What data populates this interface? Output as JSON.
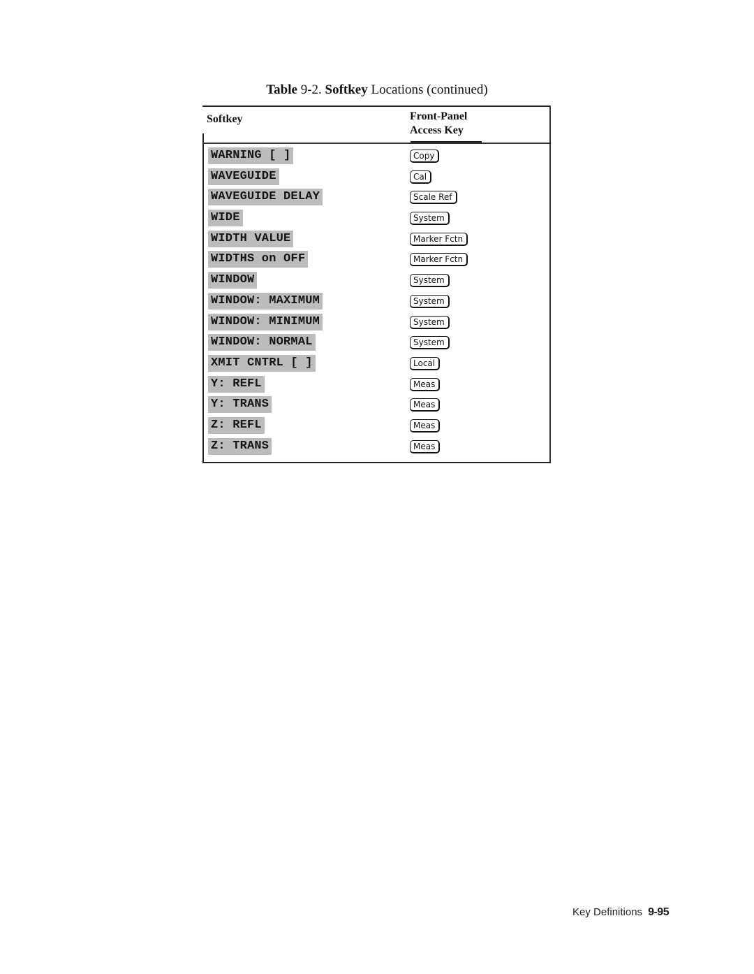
{
  "caption": {
    "prefix": "Table",
    "number": "9-2.",
    "bold_word": "Softkey",
    "rest": "Locations (continued)"
  },
  "table": {
    "headers": {
      "softkey": "Softkey",
      "access_line1": "Front-Panel",
      "access_line2": "Access Key"
    },
    "rows": [
      {
        "softkey": "WARNING [ ]",
        "access_key": "Copy"
      },
      {
        "softkey": "WAVEGUIDE",
        "access_key": "Cal"
      },
      {
        "softkey": "WAVEGUIDE DELAY",
        "access_key": "Scale Ref"
      },
      {
        "softkey": "WIDE",
        "access_key": "System"
      },
      {
        "softkey": "WIDTH VALUE",
        "access_key": "Marker Fctn"
      },
      {
        "softkey": "WIDTHS on OFF",
        "access_key": "Marker Fctn"
      },
      {
        "softkey": "WINDOW",
        "access_key": "System"
      },
      {
        "softkey": "WINDOW: MAXIMUM",
        "access_key": "System"
      },
      {
        "softkey": "WINDOW: MINIMUM",
        "access_key": "System"
      },
      {
        "softkey": "WINDOW: NORMAL",
        "access_key": "System"
      },
      {
        "softkey": "XMIT CNTRL [ ]",
        "access_key": "Local"
      },
      {
        "softkey": "Y: REFL",
        "access_key": "Meas"
      },
      {
        "softkey": "Y: TRANS",
        "access_key": "Meas"
      },
      {
        "softkey": "Z: REFL",
        "access_key": "Meas"
      },
      {
        "softkey": "Z: TRANS",
        "access_key": "Meas"
      }
    ]
  },
  "footer": {
    "section": "Key Definitions",
    "page": "9-95"
  }
}
